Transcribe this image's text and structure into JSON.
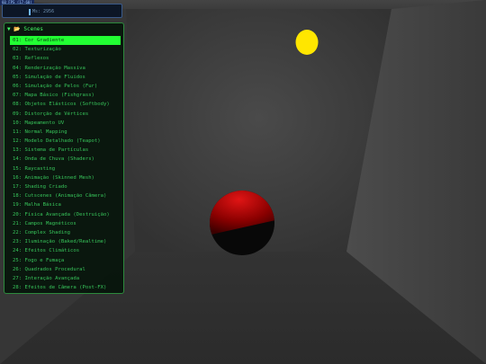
{
  "overlay": {
    "fps_label": "60 FPS (17-60)",
    "top_text": "Ms: 2956"
  },
  "panel": {
    "title": "Scenes",
    "toggle_glyph": "▼",
    "folder_glyph": "📂",
    "selected_index": 0,
    "items": [
      "01: Cor Gradiente",
      "02: Texturização",
      "03: Reflexos",
      "04: Renderização Massiva",
      "05: Simulação de Fluidos",
      "06: Simulação de Pelos (Fur)",
      "07: Mapa Básico (Fishgrass)",
      "08: Objetos Elásticos (Softbody)",
      "09: Distorção de Vértices",
      "10: Mapeamento UV",
      "11: Normal Mapping",
      "12: Modelo Detalhado (Teapot)",
      "13: Sistema de Partículas",
      "14: Onda de Chuva (Shaders)",
      "15: Raycasting",
      "16: Animação (Skinned Mesh)",
      "17: Shading Criado",
      "18: Cutscenes (Animação Câmera)",
      "19: Malha Básica",
      "20: Física Avançada (Destruição)",
      "21: Campos Magnéticos",
      "22: Complex Shading",
      "23: Iluminação (Baked/Realtime)",
      "24: Efeitos Climáticos",
      "25: Fogo e Fumaça",
      "26: Quadrados Procedural",
      "27: Interação Avançada",
      "28: Efeitos de Câmera (Post-FX)"
    ]
  },
  "colors": {
    "panel_text": "#37c45a",
    "selected_bg": "#22ff33",
    "header": "#44ff66",
    "sphere_red": "#c00000",
    "light": "#ffe600"
  }
}
